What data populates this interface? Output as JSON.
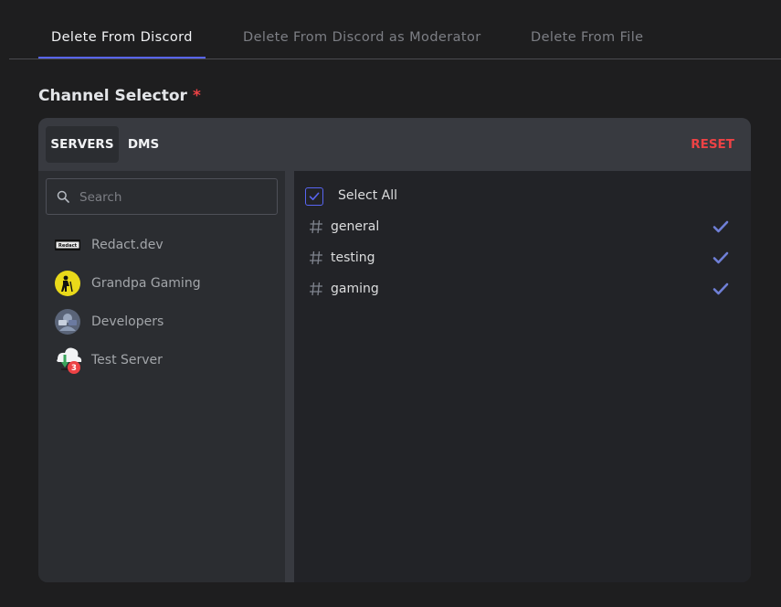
{
  "tabs": [
    {
      "label": "Delete From Discord",
      "active": true
    },
    {
      "label": "Delete From Discord as Moderator",
      "active": false
    },
    {
      "label": "Delete From File",
      "active": false
    }
  ],
  "section": {
    "title": "Channel Selector",
    "required_mark": "*"
  },
  "selector": {
    "modes": {
      "servers": "SERVERS",
      "dms": "DMS"
    },
    "active_mode": "servers",
    "reset_label": "RESET"
  },
  "search": {
    "placeholder": "Search",
    "value": "",
    "icon": "search-icon"
  },
  "servers": [
    {
      "name": "Redact.dev",
      "icon": "redact-logo",
      "icon_text": "Redact"
    },
    {
      "name": "Grandpa Gaming",
      "icon": "grandpa-gaming-avatar"
    },
    {
      "name": "Developers",
      "icon": "developers-avatar"
    },
    {
      "name": "Test Server",
      "icon": "download-cloud-icon",
      "badge": "3"
    }
  ],
  "channels": {
    "select_all_label": "Select All",
    "select_all_checked": true,
    "items": [
      {
        "name": "general",
        "selected": true
      },
      {
        "name": "testing",
        "selected": true
      },
      {
        "name": "gaming",
        "selected": true
      }
    ]
  },
  "colors": {
    "accent": "#5865f2",
    "danger": "#ed4245",
    "background": "#1e1e1f",
    "panel": "#2b2d31",
    "panel_header": "#383a40",
    "channel_pane": "#222327"
  }
}
